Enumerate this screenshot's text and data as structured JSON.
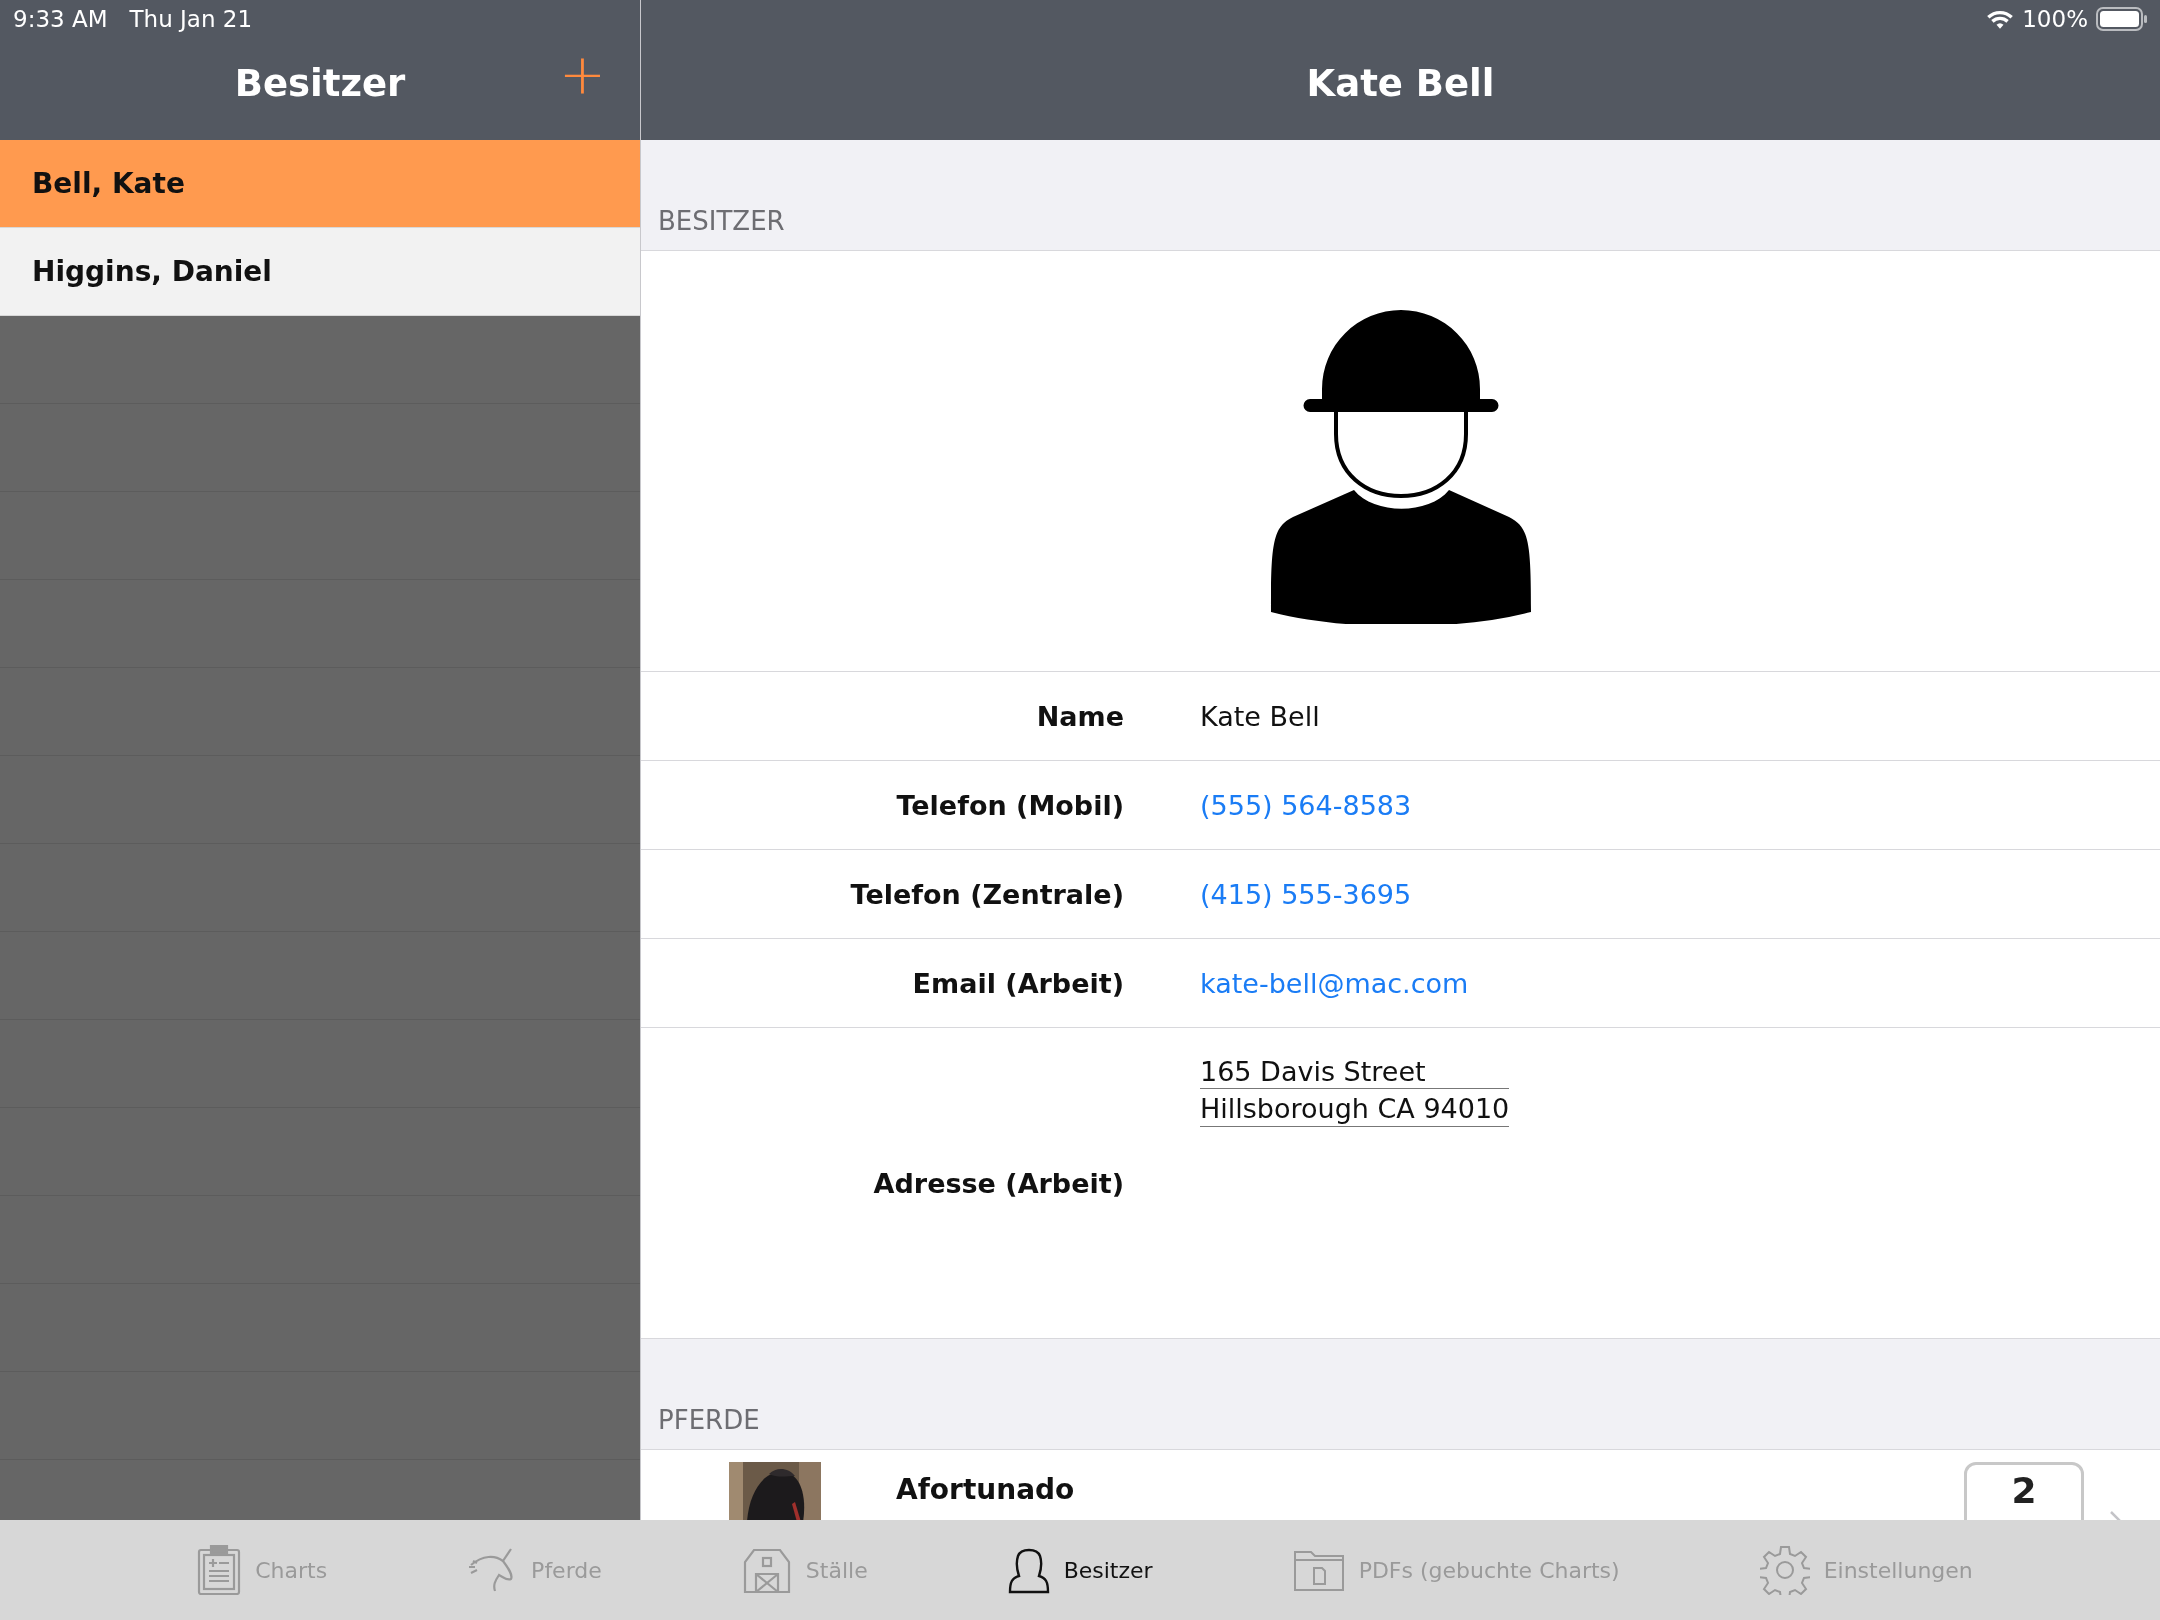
{
  "status_bar": {
    "time": "9:33 AM",
    "date": "Thu Jan 21",
    "battery": "100%"
  },
  "sidebar": {
    "title": "Besitzer",
    "add_button": "+",
    "items": [
      {
        "label": "Bell, Kate",
        "selected": true
      },
      {
        "label": "Higgins, Daniel",
        "selected": false
      }
    ]
  },
  "detail": {
    "title": "Kate Bell",
    "section_owner": "BESITZER",
    "fields": [
      {
        "label": "Name",
        "kind": "text",
        "value": "Kate Bell"
      },
      {
        "label": "Telefon (Mobil)",
        "kind": "link",
        "value": "(555) 564-8583"
      },
      {
        "label": "Telefon (Zentrale)",
        "kind": "link",
        "value": "(415) 555-3695"
      },
      {
        "label": "Email (Arbeit)",
        "kind": "link",
        "value": "kate-bell@mac.com"
      },
      {
        "label": "Adresse (Arbeit)",
        "kind": "address",
        "lines": [
          "165 Davis Street",
          "Hillsborough CA 94010"
        ]
      }
    ],
    "section_horses": "PFERDE",
    "horses": [
      {
        "name": "Afortunado",
        "count": "2"
      }
    ]
  },
  "tabs": [
    {
      "label": "Charts",
      "kind": "clipboard",
      "selected": false
    },
    {
      "label": "Pferde",
      "kind": "horse",
      "selected": false
    },
    {
      "label": "Ställe",
      "kind": "barn",
      "selected": false
    },
    {
      "label": "Besitzer",
      "kind": "person",
      "selected": true
    },
    {
      "label": "PDFs (gebuchte Charts)",
      "kind": "folder",
      "selected": false
    },
    {
      "label": "Einstellungen",
      "kind": "gear",
      "selected": false
    }
  ]
}
